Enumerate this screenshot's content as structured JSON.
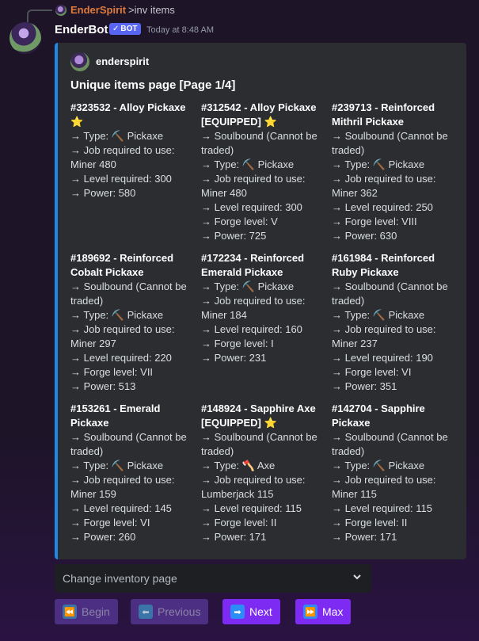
{
  "reply": {
    "username": "EnderSpirit",
    "content": ">inv items"
  },
  "message": {
    "author": "EnderBot",
    "badge": "BOT",
    "badge_icon": "checkmark-icon",
    "timestamp": "Today at 8:48 AM"
  },
  "embed": {
    "accent_color": "#1e88e5",
    "author": "enderspirit",
    "title": "Unique items page [Page 1/4]",
    "fields": [
      {
        "name": "#323532 - Alloy Pickaxe",
        "name_star": "⭐",
        "lines": [
          "→ Type: ⛏️ Pickaxe",
          "→ Job required to use: Miner 480",
          "→ Level required: 300",
          "→ Power: 580"
        ]
      },
      {
        "name": "#312542 - Alloy Pickaxe [EQUIPPED]",
        "name_star": "⭐",
        "lines": [
          "→ Soulbound (Cannot be traded)",
          "→ Type: ⛏️ Pickaxe",
          "→ Job required to use: Miner 480",
          "→ Level required: 300",
          "→ Forge level: V",
          "→ Power: 725"
        ]
      },
      {
        "name": "#239713 - Reinforced Mithril Pickaxe",
        "name_star": "",
        "lines": [
          "→ Soulbound (Cannot be traded)",
          "→ Type: ⛏️ Pickaxe",
          "→ Job required to use: Miner 362",
          "→ Level required: 250",
          "→ Forge level: VIII",
          "→ Power: 630"
        ]
      },
      {
        "name": "#189692 - Reinforced Cobalt Pickaxe",
        "name_star": "",
        "lines": [
          "→ Soulbound (Cannot be traded)",
          "→ Type: ⛏️ Pickaxe",
          "→ Job required to use: Miner 297",
          "→ Level required: 220",
          "→ Forge level: VII",
          "→ Power: 513"
        ]
      },
      {
        "name": "#172234 - Reinforced Emerald Pickaxe",
        "name_star": "",
        "lines": [
          "→ Type: ⛏️ Pickaxe",
          "→ Job required to use: Miner 184",
          "→ Level required: 160",
          "→ Forge level: I",
          "→ Power: 231"
        ]
      },
      {
        "name": "#161984 - Reinforced Ruby Pickaxe",
        "name_star": "",
        "lines": [
          "→ Soulbound (Cannot be traded)",
          "→ Type: ⛏️ Pickaxe",
          "→ Job required to use: Miner 237",
          "→ Level required: 190",
          "→ Forge level: VI",
          "→ Power: 351"
        ]
      },
      {
        "name": "#153261 - Emerald Pickaxe",
        "name_star": "",
        "lines": [
          "→ Soulbound (Cannot be traded)",
          "→ Type: ⛏️ Pickaxe",
          "→ Job required to use: Miner 159",
          "→ Level required: 145",
          "→ Forge level: VI",
          "→ Power: 260"
        ]
      },
      {
        "name": "#148924 - Sapphire Axe [EQUIPPED]",
        "name_star": "⭐",
        "lines": [
          "→ Soulbound (Cannot be traded)",
          "→ Type: 🪓 Axe",
          "→ Job required to use: Lumberjack 115",
          "→ Level required: 115",
          "→ Forge level: II",
          "→ Power: 171"
        ]
      },
      {
        "name": "#142704 - Sapphire Pickaxe",
        "name_star": "",
        "lines": [
          "→ Soulbound (Cannot be traded)",
          "→ Type: ⛏️ Pickaxe",
          "→ Job required to use: Miner 115",
          "→ Level required: 115",
          "→ Forge level: II",
          "→ Power: 171"
        ]
      }
    ]
  },
  "select_menu": {
    "placeholder": "Change inventory page",
    "icon": "chevron-down-icon"
  },
  "buttons": [
    {
      "label": "Begin",
      "icon": "rewind-icon",
      "glyph": "⏪",
      "disabled": true
    },
    {
      "label": "Previous",
      "icon": "arrow-left-icon",
      "glyph": "⬅",
      "disabled": true
    },
    {
      "label": "Next",
      "icon": "arrow-right-icon",
      "glyph": "➡",
      "disabled": false
    },
    {
      "label": "Max",
      "icon": "fast-forward-icon",
      "glyph": "⏩",
      "disabled": false
    }
  ]
}
